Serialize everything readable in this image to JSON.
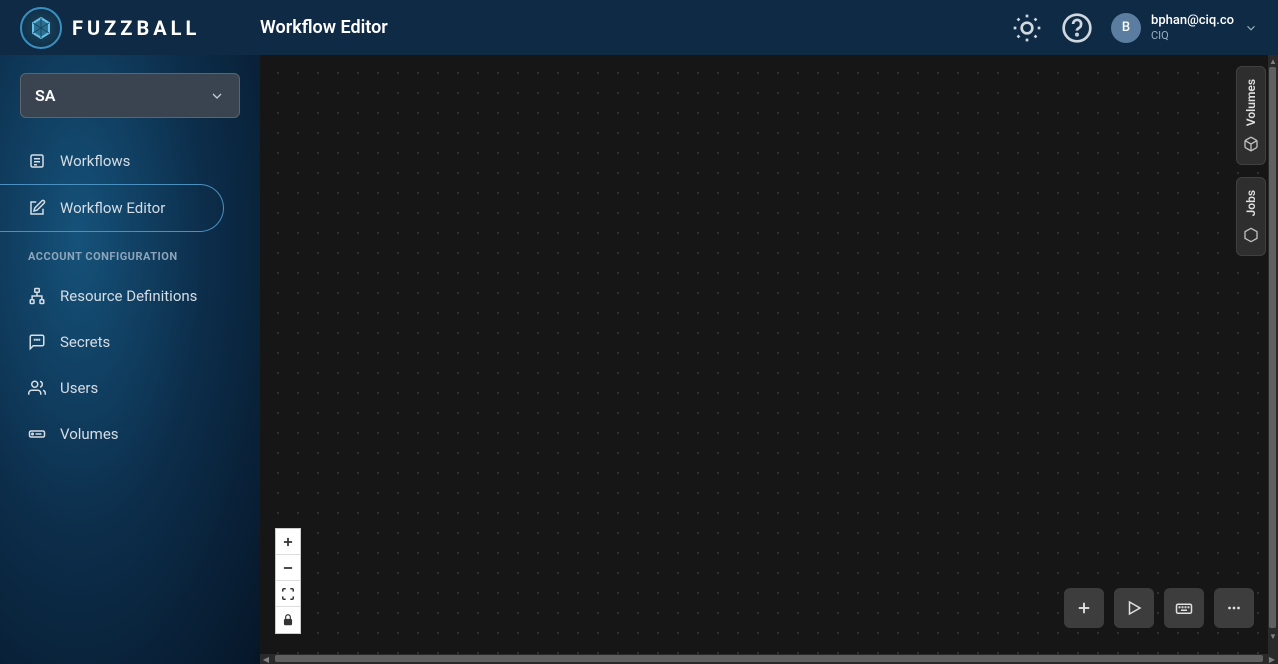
{
  "header": {
    "app_name": "FUZZBALL",
    "page_title": "Workflow Editor",
    "user": {
      "avatar_initial": "B",
      "email": "bphan@ciq.co",
      "org": "CIQ"
    }
  },
  "sidebar": {
    "org_selected": "SA",
    "items": [
      {
        "label": "Workflows",
        "icon": "list-icon"
      },
      {
        "label": "Workflow Editor",
        "icon": "edit-icon",
        "active": true
      }
    ],
    "section_header": "ACCOUNT CONFIGURATION",
    "config_items": [
      {
        "label": "Resource Definitions",
        "icon": "sitemap-icon"
      },
      {
        "label": "Secrets",
        "icon": "message-lock-icon"
      },
      {
        "label": "Users",
        "icon": "users-icon"
      },
      {
        "label": "Volumes",
        "icon": "drive-icon"
      }
    ]
  },
  "side_tabs": {
    "volumes_label": "Volumes",
    "jobs_label": "Jobs"
  }
}
